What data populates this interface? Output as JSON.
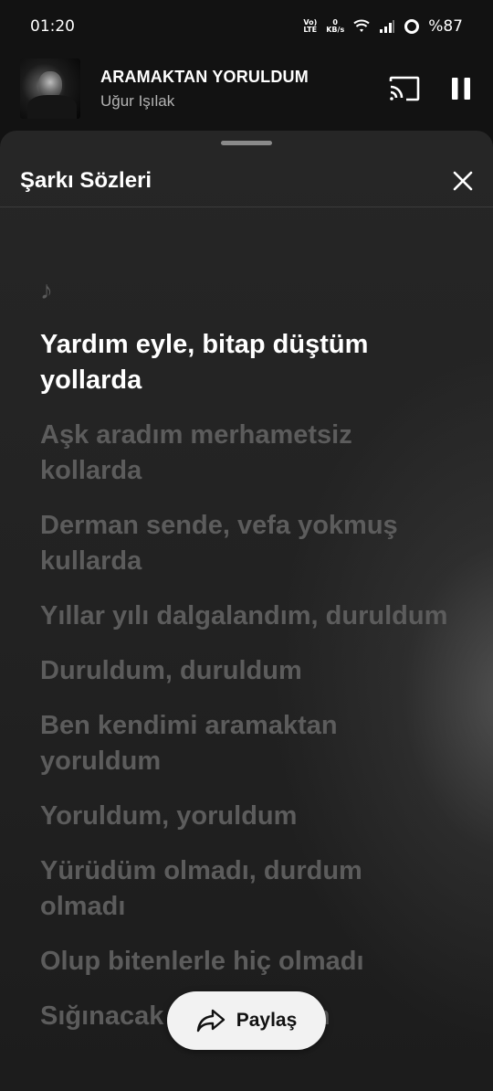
{
  "status_bar": {
    "time": "01:20",
    "volte_top": "Vo)",
    "volte_bottom": "LTE",
    "speed_value": "0",
    "speed_unit": "KB/s",
    "battery": "%87"
  },
  "mini_player": {
    "title": "ARAMAKTAN YORULDUM",
    "artist": "Uğur Işılak",
    "cast_icon": "cast-icon",
    "pause_icon": "pause-icon"
  },
  "sheet": {
    "title": "Şarkı Sözleri",
    "close_icon": "close-icon"
  },
  "lyrics": {
    "note": "♪",
    "lines": [
      {
        "text": "Yardım eyle, bitap düştüm yollarda",
        "active": true
      },
      {
        "text": "Aşk aradım merhametsiz kollarda",
        "active": false
      },
      {
        "text": "Derman sende, vefa yokmuş kullarda",
        "active": false
      },
      {
        "text": "Yıllar yılı dalgalandım, duruldum",
        "active": false
      },
      {
        "text": "Duruldum, duruldum",
        "active": false
      },
      {
        "text": "Ben kendimi aramaktan yoruldum",
        "active": false
      },
      {
        "text": "Yoruldum, yoruldum",
        "active": false
      },
      {
        "text": "Yürüdüm olmadı, durdum olmadı",
        "active": false
      },
      {
        "text": "Olup bitenlerle hiç olmadı",
        "active": false
      },
      {
        "text": "Sığınacak başka kapım",
        "active": false
      }
    ]
  },
  "share": {
    "label": "Paylaş",
    "icon": "share-arrow-icon"
  }
}
